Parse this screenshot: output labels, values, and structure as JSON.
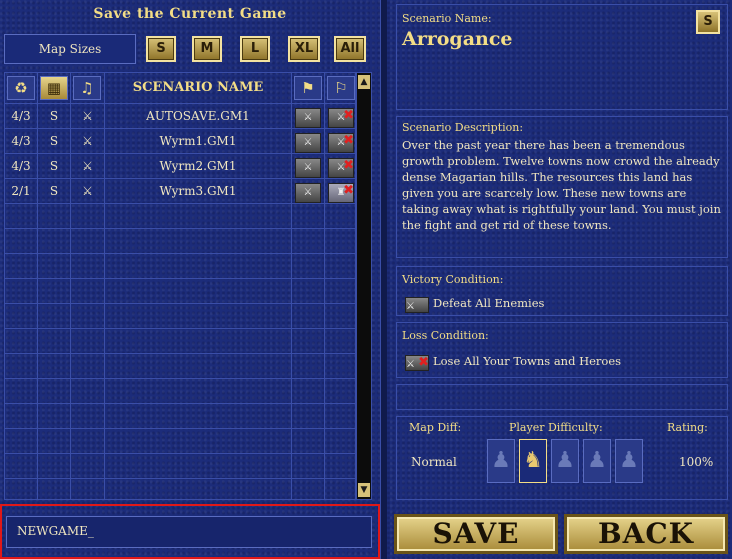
{
  "left": {
    "title": "Save the Current Game",
    "map_sizes_label": "Map Sizes",
    "size_buttons": [
      "S",
      "M",
      "L",
      "XL",
      "All"
    ],
    "column_header_name": "SCENARIO NAME",
    "rows": [
      {
        "players": "4/3",
        "size": "S",
        "name": "AUTOSAVE.GM1"
      },
      {
        "players": "4/3",
        "size": "S",
        "name": "Wyrm1.GM1"
      },
      {
        "players": "4/3",
        "size": "S",
        "name": "Wyrm2.GM1"
      },
      {
        "players": "2/1",
        "size": "S",
        "name": "Wyrm3.GM1"
      }
    ],
    "filename_value": "NEWGAME_"
  },
  "right": {
    "scenario_name_label": "Scenario Name:",
    "scenario_name": "Arrogance",
    "size_badge": "S",
    "description_label": "Scenario Description:",
    "description": "Over the past year there has been a tremendous growth problem. Twelve towns now crowd the already dense Magarian hills. The resources this land has given you are scarcely low. These new towns are taking away what is rightfully your land. You must join the fight and get rid of these towns.",
    "victory_label": "Victory Condition:",
    "victory_text": "Defeat All Enemies",
    "loss_label": "Loss Condition:",
    "loss_text": "Lose All Your Towns and Heroes",
    "map_diff_label": "Map Diff:",
    "player_diff_label": "Player Difficulty:",
    "rating_label": "Rating:",
    "map_diff_value": "Normal",
    "rating_value": "100%",
    "player_difficulty_selected_index": 1
  },
  "buttons": {
    "save": "SAVE",
    "back": "BACK"
  },
  "colors": {
    "background": "#1c2c7a",
    "gold_text": "#f3dd86",
    "highlight_border": "#e01818"
  }
}
